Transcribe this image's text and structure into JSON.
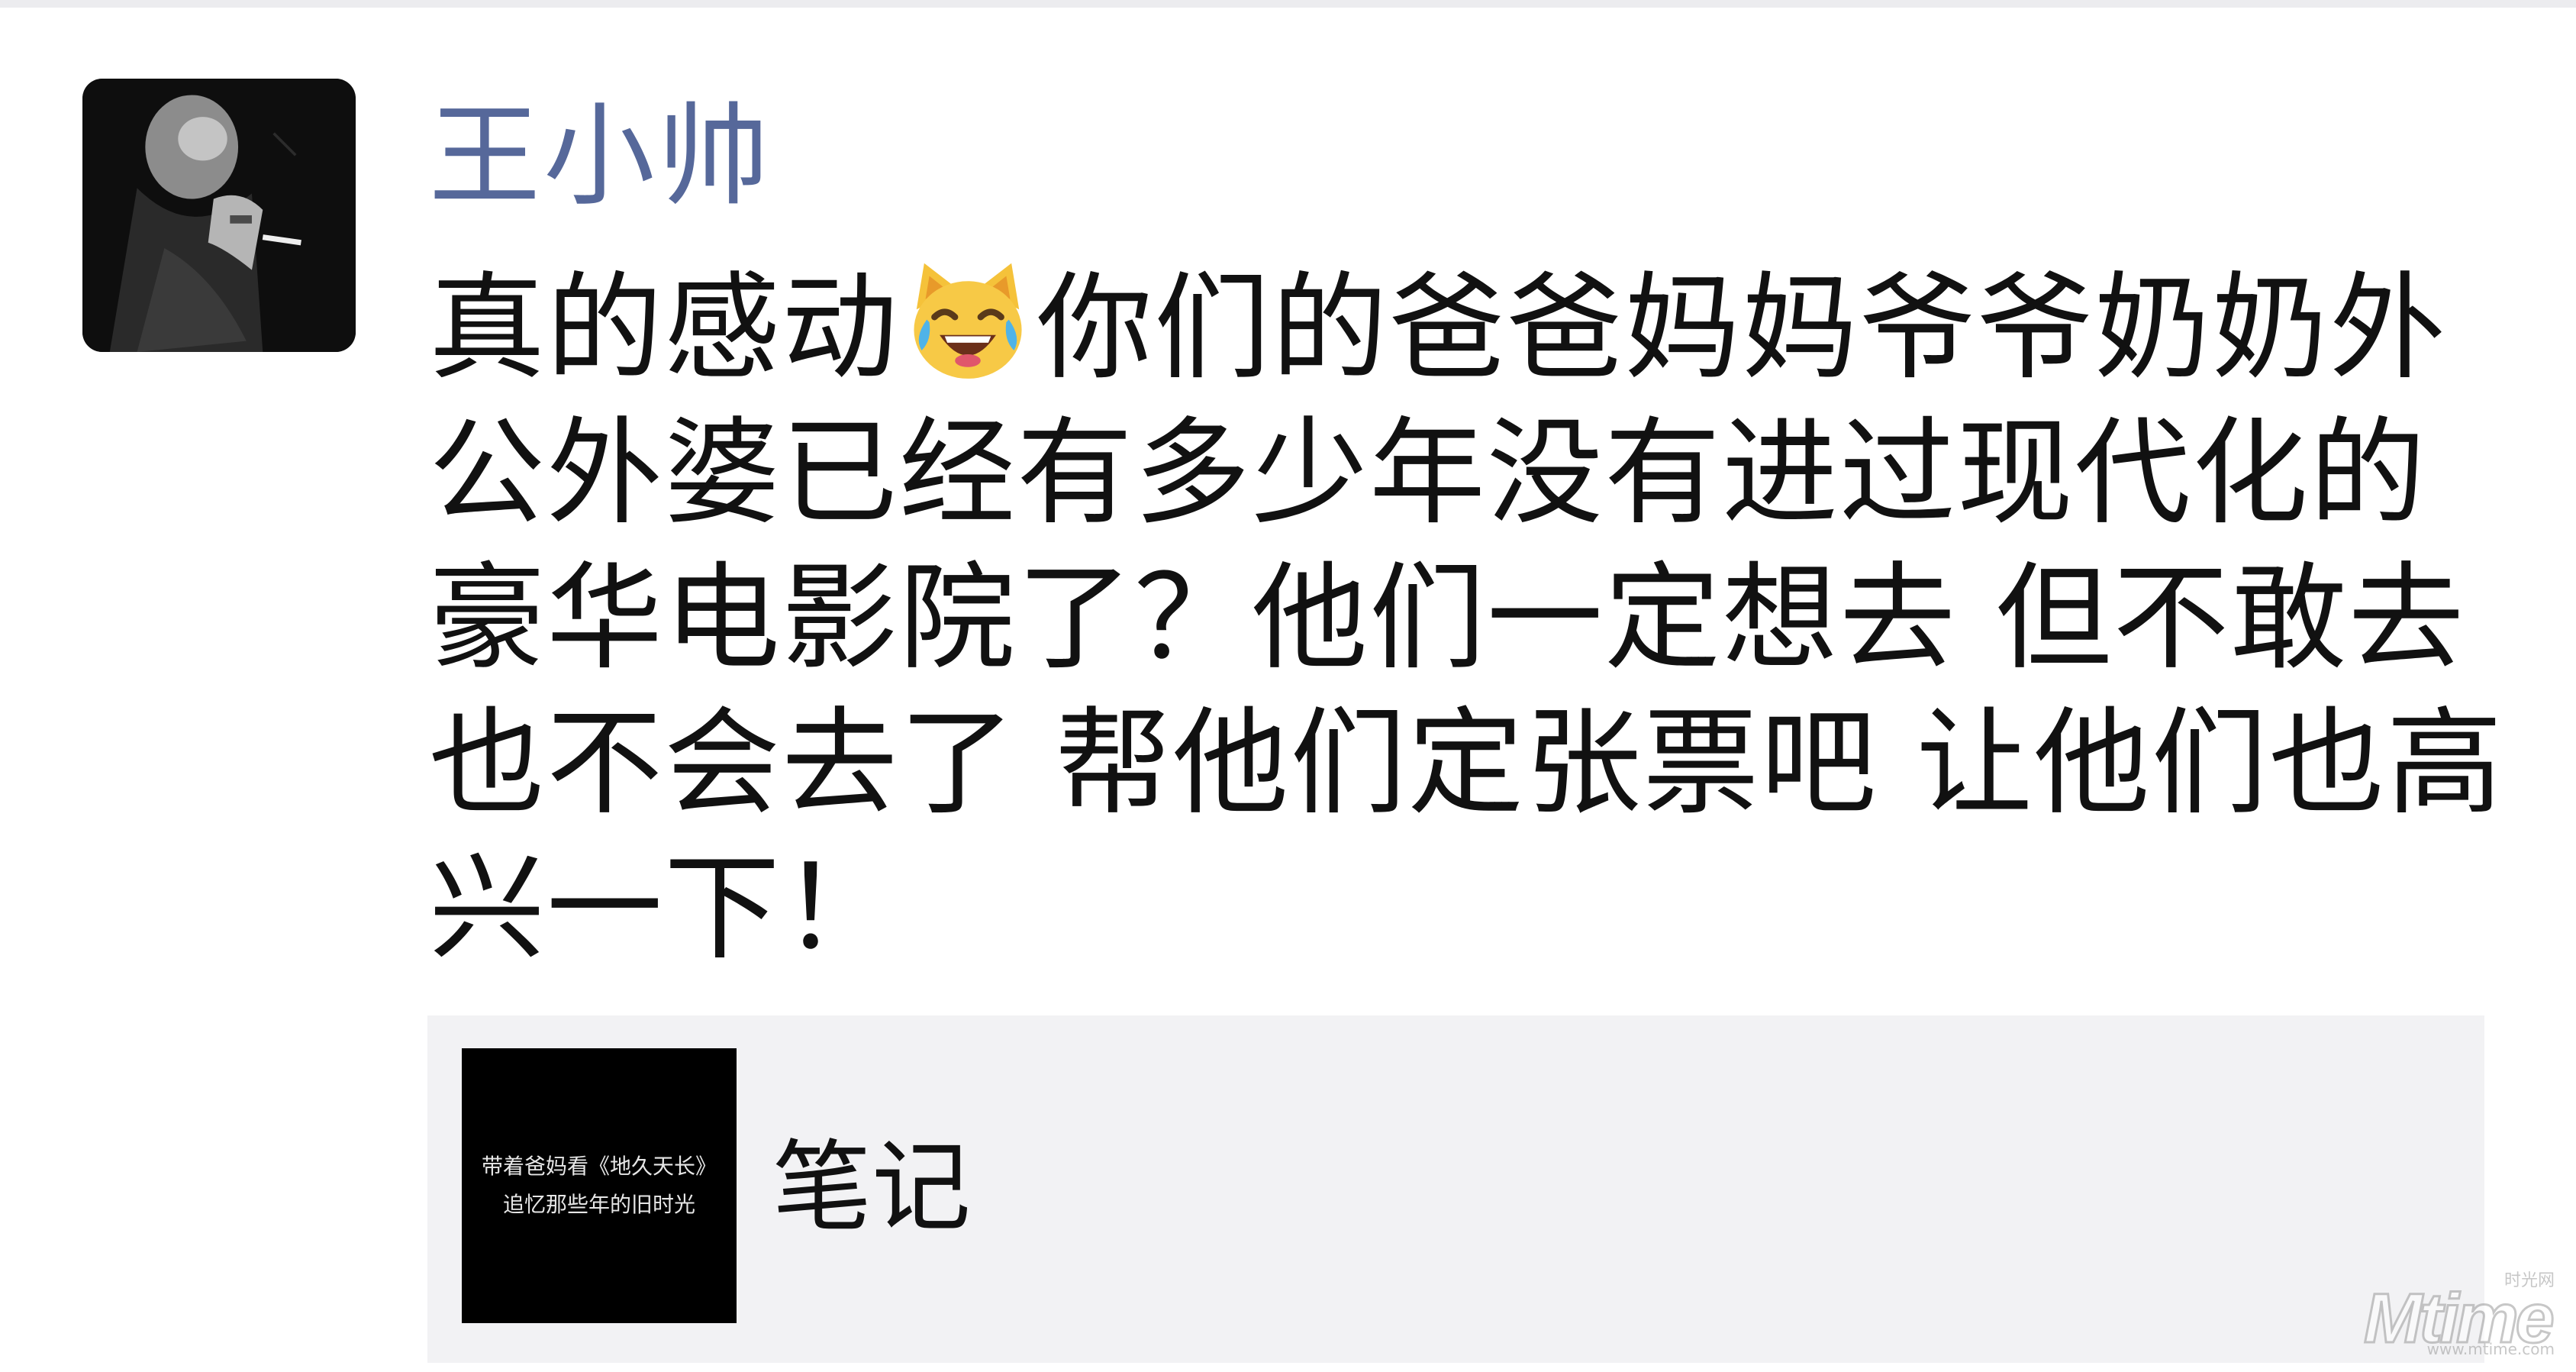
{
  "post": {
    "author_name": "王小帅",
    "avatar_icon": "person-smoking-avatar",
    "content_before_emoji": "真的感动",
    "emoji": "joy-cat-emoji",
    "content_after_emoji": "你们的爸爸妈妈爷爷奶奶外公外婆已经有多少年没有进过现代化的豪华电影院了？他们一定想去 但不敢去 也不会去了 帮他们定张票吧 让他们也高兴一下！"
  },
  "share_card": {
    "thumbnail_line1": "带着爸妈看《地久天长》",
    "thumbnail_line2": "追忆那些年的旧时光",
    "title": "笔记"
  },
  "watermark": {
    "logo": "Mtime",
    "cn": "时光网",
    "url": "www.mtime.com"
  },
  "colors": {
    "author_name": "#56689a",
    "card_background": "#f2f2f4",
    "text": "#111111"
  }
}
